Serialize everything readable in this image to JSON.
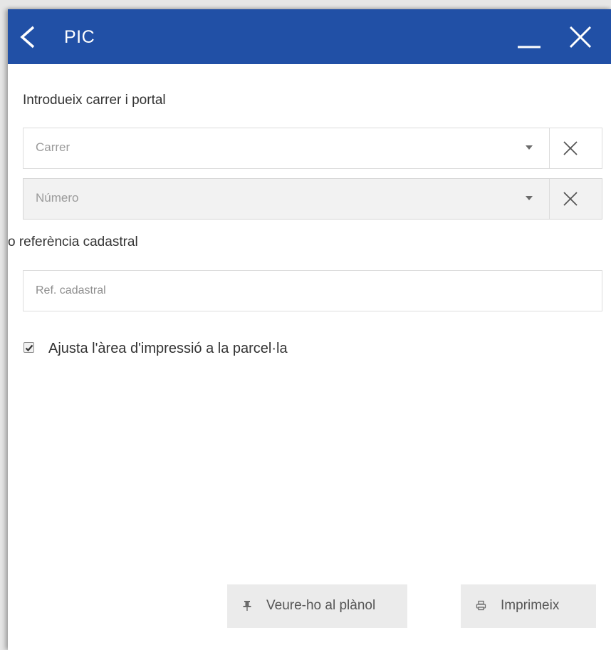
{
  "header": {
    "title": "PIC",
    "back_icon": "chevron-left-icon",
    "minimize_icon": "minimize-icon",
    "close_icon": "close-icon",
    "accent_color": "#2150a6"
  },
  "form": {
    "street_section_label": "Introdueix carrer i portal",
    "street_select": {
      "placeholder": "Carrer",
      "value": ""
    },
    "number_select": {
      "placeholder": "Número",
      "value": "",
      "disabled": true
    },
    "cadastral_section_label": "o referència cadastral",
    "cadastral_input": {
      "placeholder": "Ref. cadastral",
      "value": ""
    },
    "fit_print_area": {
      "label": "Ajusta l'àrea d'impressió a la parcel·la",
      "checked": true
    }
  },
  "actions": {
    "show_on_map": {
      "label": "Veure-ho al plànol",
      "icon": "pin-icon"
    },
    "print": {
      "label": "Imprimeix",
      "icon": "printer-icon"
    }
  }
}
